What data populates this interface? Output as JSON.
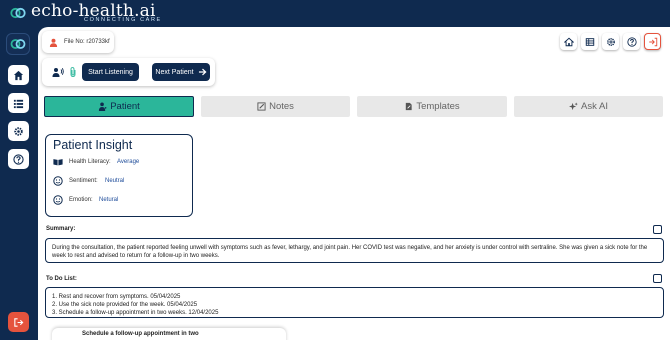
{
  "brand": {
    "name": "echo-health.ai",
    "tagline": "CONNECTING CARE"
  },
  "file": {
    "label": "File No: r20733kf"
  },
  "controls": {
    "start_label": "Start Listening",
    "next_label": "Next Patient"
  },
  "tabs": [
    {
      "label": "Patient",
      "icon": "patient-icon",
      "active": true
    },
    {
      "label": "Notes",
      "icon": "notes-icon",
      "active": false
    },
    {
      "label": "Templates",
      "icon": "templates-icon",
      "active": false
    },
    {
      "label": "Ask AI",
      "icon": "sparkle-icon",
      "active": false
    }
  ],
  "insight": {
    "title": "Patient Insight",
    "rows": [
      {
        "label": "Health Literacy:",
        "value": "Average",
        "icon": "book-icon"
      },
      {
        "label": "Sentiment:",
        "value": "Neutral",
        "icon": "smiley-icon"
      },
      {
        "label": "Emotion:",
        "value": "Netural",
        "icon": "smiley-icon"
      }
    ]
  },
  "summary": {
    "label": "Summary:",
    "text": "During the consultation, the patient reported feeling unwell with symptoms such as fever, lethargy, and joint pain. Her COVID test was negative, and her anxiety is under control with sertraline. She was given a sick note for the week to rest and advised to return for a follow-up in two weeks."
  },
  "todo": {
    "label": "To Do List:",
    "items": [
      "1. Rest and recover from symptoms. 05/04/2025",
      "2. Use the sick note provided for the week. 05/04/2025",
      "3. Schedule a follow-up appointment in two weeks. 12/04/2025"
    ]
  },
  "followup": {
    "text": "Schedule a follow-up appointment in two"
  },
  "colors": {
    "navy": "#0f2a4f",
    "teal": "#2bb69a",
    "danger": "#e5533d",
    "link": "#1e4c9a"
  }
}
